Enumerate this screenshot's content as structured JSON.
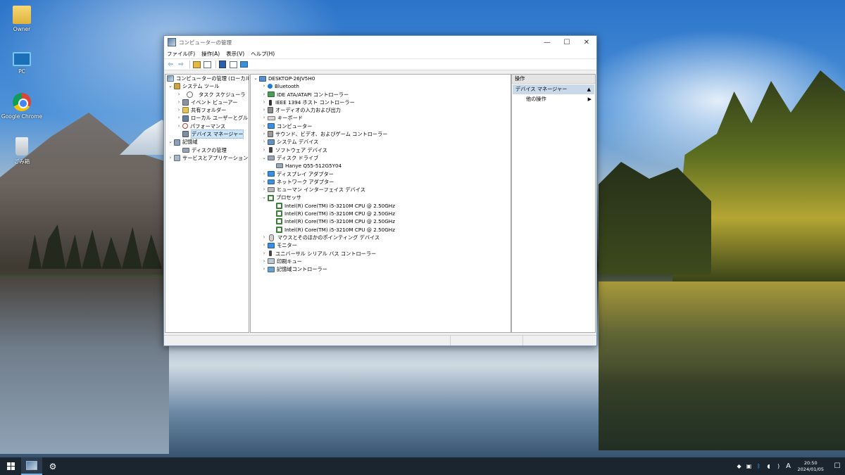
{
  "desktop": {
    "icons": [
      {
        "label": "Owner",
        "icon": "user-folder-icon"
      },
      {
        "label": "PC",
        "icon": "pc-icon"
      },
      {
        "label": "Google Chrome",
        "icon": "chrome-icon"
      },
      {
        "label": "ごみ箱",
        "icon": "recycle-bin-icon"
      }
    ]
  },
  "window": {
    "title": "コンピューターの管理",
    "controls": {
      "minimize": "—",
      "maximize": "☐",
      "close": "✕"
    },
    "menu": [
      "ファイル(F)",
      "操作(A)",
      "表示(V)",
      "ヘルプ(H)"
    ],
    "toolbar": {
      "back": "⇦",
      "forward": "⇨"
    }
  },
  "left_tree": {
    "root": "コンピューターの管理 (ローカル)",
    "system_tools": "システム ツール",
    "task_scheduler": "タスク スケジューラ",
    "event_viewer": "イベント ビューアー",
    "shared_folders": "共有フォルダー",
    "local_users": "ローカル ユーザーとグループ",
    "performance": "パフォーマンス",
    "device_manager": "デバイス マネージャー",
    "storage": "記憶域",
    "disk_management": "ディスクの管理",
    "services_apps": "サービスとアプリケーション"
  },
  "device_tree": {
    "computer": "DESKTOP-26JV5H0",
    "categories": {
      "bluetooth": "Bluetooth",
      "ide": "IDE ATA/ATAPI コントローラー",
      "ieee1394": "IEEE 1394 ホスト コントローラー",
      "audio_io": "オーディオの入力および出力",
      "keyboard": "キーボード",
      "computer": "コンピューター",
      "sound": "サウンド、ビデオ、およびゲーム コントローラー",
      "system": "システム デバイス",
      "software": "ソフトウェア デバイス",
      "disk": "ディスク ドライブ",
      "display": "ディスプレイ アダプター",
      "network": "ネットワーク アダプター",
      "hid": "ヒューマン インターフェイス デバイス",
      "processor": "プロセッサ",
      "mouse": "マウスとそのほかのポインティング デバイス",
      "monitor": "モニター",
      "usb": "ユニバーサル シリアル バス コントローラー",
      "print_queue": "印刷キュー",
      "storage_ctrl": "記憶域コントローラー"
    },
    "disk_item": "Hanye Q55-512G5Y04",
    "cpus": [
      "Intel(R) Core(TM) i5-3210M CPU @ 2.50GHz",
      "Intel(R) Core(TM) i5-3210M CPU @ 2.50GHz",
      "Intel(R) Core(TM) i5-3210M CPU @ 2.50GHz",
      "Intel(R) Core(TM) i5-3210M CPU @ 2.50GHz"
    ]
  },
  "actions": {
    "header": "操作",
    "section": "デバイス マネージャー",
    "other": "他の操作"
  },
  "taskbar": {
    "time": "20:50",
    "date": "2024/01/05",
    "ime": "A"
  }
}
